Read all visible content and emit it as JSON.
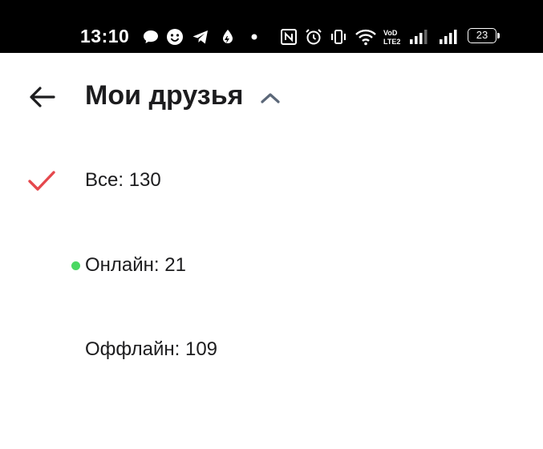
{
  "status_bar": {
    "time": "13:10",
    "icons": [
      "chat-bubble-icon",
      "smiley-icon",
      "telegram-icon",
      "drop-icon",
      "dot-icon",
      "nfc-icon",
      "alarm-icon",
      "vibrate-icon",
      "wifi-icon",
      "volte-icon",
      "signal-icon",
      "signal-icon"
    ],
    "volte_label": "VoD\nLTE2",
    "battery_level": "23"
  },
  "header": {
    "title": "Мои друзья",
    "back_icon": "arrow-left-icon",
    "toggle_icon": "chevron-up-icon",
    "chevron_color": "#5b6778"
  },
  "filters": [
    {
      "label": "Все: 130",
      "selected": true,
      "icon": "checkmark-icon",
      "icon_color": "#e5484d"
    },
    {
      "label": "Онлайн: 21",
      "selected": false,
      "indicator": "online-dot",
      "indicator_color": "#4bd863"
    },
    {
      "label": "Оффлайн: 109",
      "selected": false
    }
  ]
}
